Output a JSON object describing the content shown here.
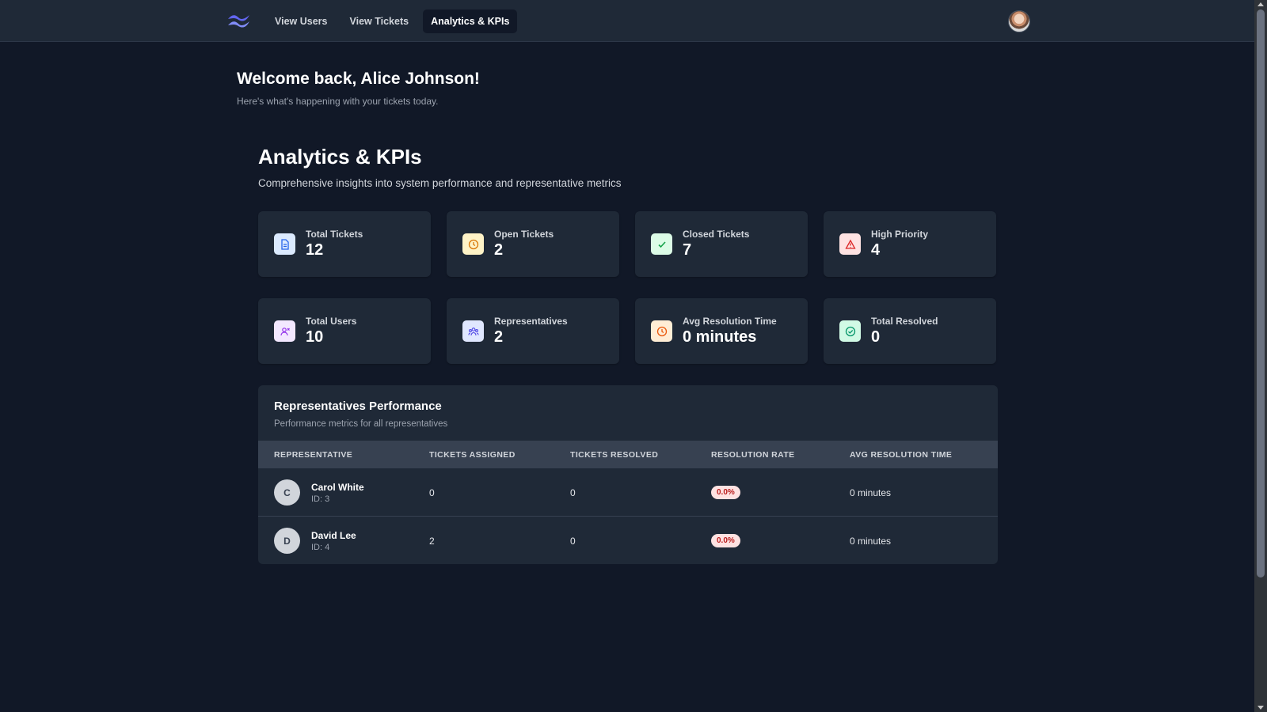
{
  "nav": {
    "items": [
      "View Users",
      "View Tickets",
      "Analytics & KPIs"
    ],
    "active_index": 2
  },
  "welcome": {
    "title": "Welcome back, Alice Johnson!",
    "subtitle": "Here's what's happening with your tickets today."
  },
  "analytics": {
    "title": "Analytics & KPIs",
    "subtitle": "Comprehensive insights into system performance and representative metrics"
  },
  "kpis": [
    {
      "label": "Total Tickets",
      "value": "12",
      "icon": "document-icon",
      "color": "#2563eb"
    },
    {
      "label": "Open Tickets",
      "value": "2",
      "icon": "clock-icon",
      "color": "#d97706"
    },
    {
      "label": "Closed Tickets",
      "value": "7",
      "icon": "check-icon",
      "color": "#16a34a"
    },
    {
      "label": "High Priority",
      "value": "4",
      "icon": "warning-icon",
      "color": "#dc2626"
    },
    {
      "label": "Total Users",
      "value": "10",
      "icon": "users-icon",
      "color": "#9333ea"
    },
    {
      "label": "Representatives",
      "value": "2",
      "icon": "team-icon",
      "color": "#4f46e5"
    },
    {
      "label": "Avg Resolution Time",
      "value": "0 minutes",
      "icon": "clock-icon",
      "color": "#ea580c"
    },
    {
      "label": "Total Resolved",
      "value": "0",
      "icon": "check-circle-icon",
      "color": "#059669"
    }
  ],
  "performance": {
    "title": "Representatives Performance",
    "subtitle": "Performance metrics for all representatives",
    "columns": [
      "REPRESENTATIVE",
      "TICKETS ASSIGNED",
      "TICKETS RESOLVED",
      "RESOLUTION RATE",
      "AVG RESOLUTION TIME"
    ],
    "rows": [
      {
        "initial": "C",
        "name": "Carol White",
        "id": "ID: 3",
        "assigned": "0",
        "resolved": "0",
        "rate": "0.0%",
        "avg": "0 minutes"
      },
      {
        "initial": "D",
        "name": "David Lee",
        "id": "ID: 4",
        "assigned": "2",
        "resolved": "0",
        "rate": "0.0%",
        "avg": "0 minutes"
      }
    ]
  }
}
